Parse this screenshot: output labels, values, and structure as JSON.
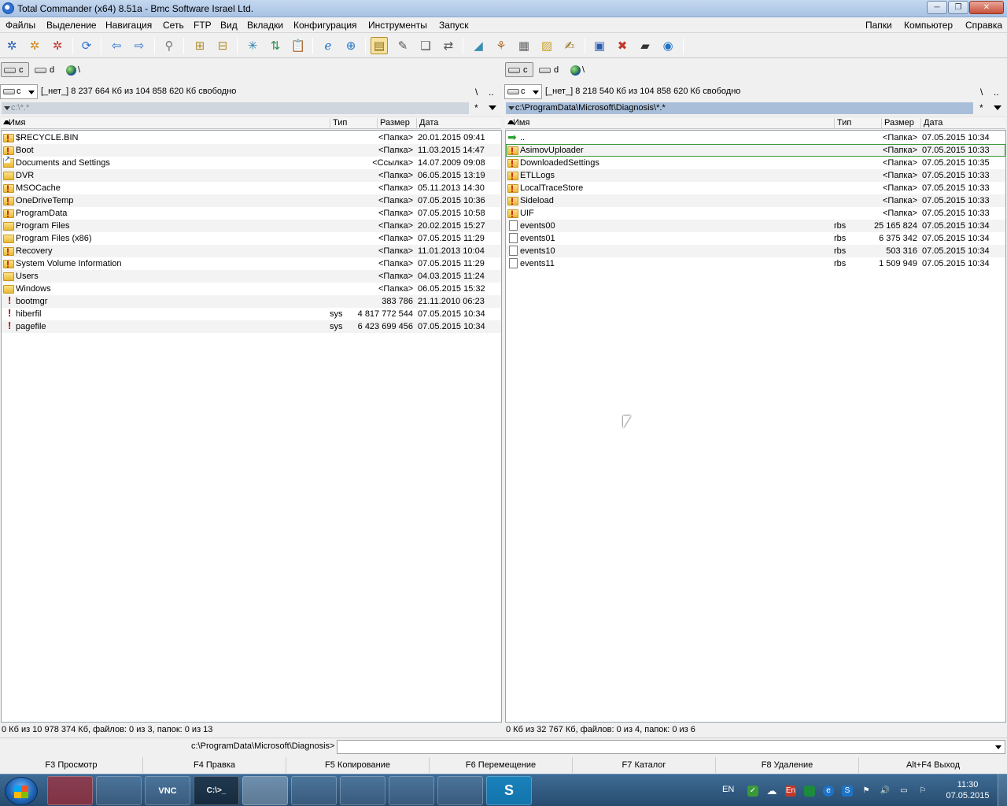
{
  "window": {
    "title": "Total Commander (x64) 8.51a - Bmc Software Israel Ltd."
  },
  "menu": {
    "left": [
      "Файлы",
      "Выделение",
      "Навигация",
      "Сеть",
      "FTP",
      "Вид",
      "Вкладки",
      "Конфигурация",
      "Инструменты",
      "Запуск"
    ],
    "right": [
      "Папки",
      "Компьютер",
      "Справка"
    ]
  },
  "toolbar": {
    "icons": [
      "gear-icon",
      "gear-icon",
      "gear-icon",
      "refresh-icon",
      "back-arrow-icon",
      "forward-arrow-icon",
      "search-icon",
      "pack-icon",
      "unpack-icon",
      "tree-icon",
      "sort-icon",
      "clipboard-icon",
      "ie-icon",
      "network-icon",
      "view-icon",
      "edit-icon",
      "copy-icon",
      "sync-icon",
      "disk-icon",
      "broom-icon",
      "calculator-icon",
      "notepad-icon",
      "notes-icon",
      "window-icon",
      "delete-icon",
      "terminal-icon",
      "globe-icon"
    ]
  },
  "left": {
    "drives": [
      "c",
      "d"
    ],
    "root": "\\",
    "combo": "c",
    "free": "[_нет_]  8 237 664 Кб из 104 858 620 Кб свободно",
    "path": "c:\\*.*",
    "cols": {
      "name": "Имя",
      "ext": "Тип",
      "size": "Размер",
      "date": "Дата"
    },
    "files": [
      {
        "icon": "excl-folder",
        "name": "$RECYCLE.BIN",
        "ext": "",
        "size": "<Папка>",
        "date": "20.01.2015 09:41"
      },
      {
        "icon": "excl-folder",
        "name": "Boot",
        "ext": "",
        "size": "<Папка>",
        "date": "11.03.2015 14:47"
      },
      {
        "icon": "link",
        "name": "Documents and Settings",
        "ext": "",
        "size": "<Ссылка>",
        "date": "14.07.2009 09:08"
      },
      {
        "icon": "folder",
        "name": "DVR",
        "ext": "",
        "size": "<Папка>",
        "date": "06.05.2015 13:19"
      },
      {
        "icon": "excl-folder",
        "name": "MSOCache",
        "ext": "",
        "size": "<Папка>",
        "date": "05.11.2013 14:30"
      },
      {
        "icon": "excl-folder",
        "name": "OneDriveTemp",
        "ext": "",
        "size": "<Папка>",
        "date": "07.05.2015 10:36"
      },
      {
        "icon": "excl-folder",
        "name": "ProgramData",
        "ext": "",
        "size": "<Папка>",
        "date": "07.05.2015 10:58"
      },
      {
        "icon": "folder",
        "name": "Program Files",
        "ext": "",
        "size": "<Папка>",
        "date": "20.02.2015 15:27"
      },
      {
        "icon": "folder",
        "name": "Program Files (x86)",
        "ext": "",
        "size": "<Папка>",
        "date": "07.05.2015 11:29"
      },
      {
        "icon": "excl-folder",
        "name": "Recovery",
        "ext": "",
        "size": "<Папка>",
        "date": "11.01.2013 10:04"
      },
      {
        "icon": "excl-folder",
        "name": "System Volume Information",
        "ext": "",
        "size": "<Папка>",
        "date": "07.05.2015 11:29"
      },
      {
        "icon": "folder",
        "name": "Users",
        "ext": "",
        "size": "<Папка>",
        "date": "04.03.2015 11:24"
      },
      {
        "icon": "folder",
        "name": "Windows",
        "ext": "",
        "size": "<Папка>",
        "date": "06.05.2015 15:32"
      },
      {
        "icon": "excl-file",
        "name": "bootmgr",
        "ext": "",
        "size": "383 786",
        "date": "21.11.2010 06:23"
      },
      {
        "icon": "excl-file",
        "name": "hiberfil",
        "ext": "sys",
        "size": "4 817 772 544",
        "date": "07.05.2015 10:34"
      },
      {
        "icon": "excl-file",
        "name": "pagefile",
        "ext": "sys",
        "size": "6 423 699 456",
        "date": "07.05.2015 10:34"
      }
    ],
    "status": "0 Кб из 10 978 374 Кб, файлов: 0 из 3, папок: 0 из 13"
  },
  "right": {
    "drives": [
      "c",
      "d"
    ],
    "root": "\\",
    "combo": "c",
    "free": "[_нет_]  8 218 540 Кб из 104 858 620 Кб свободно",
    "path": "c:\\ProgramData\\Microsoft\\Diagnosis\\*.*",
    "cols": {
      "name": "Имя",
      "ext": "Тип",
      "size": "Размер",
      "date": "Дата"
    },
    "files": [
      {
        "icon": "up",
        "name": "..",
        "ext": "",
        "size": "<Папка>",
        "date": "07.05.2015 10:34"
      },
      {
        "icon": "excl-folder",
        "name": "AsimovUploader",
        "ext": "",
        "size": "<Папка>",
        "date": "07.05.2015 10:33",
        "cursor": true
      },
      {
        "icon": "excl-folder",
        "name": "DownloadedSettings",
        "ext": "",
        "size": "<Папка>",
        "date": "07.05.2015 10:35"
      },
      {
        "icon": "excl-folder",
        "name": "ETLLogs",
        "ext": "",
        "size": "<Папка>",
        "date": "07.05.2015 10:33"
      },
      {
        "icon": "excl-folder",
        "name": "LocalTraceStore",
        "ext": "",
        "size": "<Папка>",
        "date": "07.05.2015 10:33"
      },
      {
        "icon": "excl-folder",
        "name": "Sideload",
        "ext": "",
        "size": "<Папка>",
        "date": "07.05.2015 10:33"
      },
      {
        "icon": "excl-folder",
        "name": "UIF",
        "ext": "",
        "size": "<Папка>",
        "date": "07.05.2015 10:33"
      },
      {
        "icon": "file",
        "name": "events00",
        "ext": "rbs",
        "size": "25 165 824",
        "date": "07.05.2015 10:34"
      },
      {
        "icon": "file",
        "name": "events01",
        "ext": "rbs",
        "size": "6 375 342",
        "date": "07.05.2015 10:34"
      },
      {
        "icon": "file",
        "name": "events10",
        "ext": "rbs",
        "size": "503 316",
        "date": "07.05.2015 10:34"
      },
      {
        "icon": "file",
        "name": "events11",
        "ext": "rbs",
        "size": "1 509 949",
        "date": "07.05.2015 10:34"
      }
    ],
    "status": "0 Кб из 32 767 Кб, файлов: 0 из 4, папок: 0 из 6"
  },
  "cmdline": {
    "path": "c:\\ProgramData\\Microsoft\\Diagnosis>",
    "value": ""
  },
  "fkeys": [
    "F3 Просмотр",
    "F4 Правка",
    "F5 Копирование",
    "F6 Перемещение",
    "F7 Каталог",
    "F8 Удаление",
    "Alt+F4 Выход"
  ],
  "taskbar": {
    "apps": [
      "acrobat-icon",
      "camera-icon",
      "vnc-icon",
      "cmd-icon",
      "app-icon",
      "monitor-icon",
      "floppy-icon",
      "notepad-icon",
      "folder-icon",
      "skype-icon"
    ],
    "app_labels": [
      "",
      "",
      "VNC",
      "C:\\>_",
      "",
      "",
      "",
      "",
      "",
      "S"
    ],
    "lang": "EN",
    "time": "11:30",
    "date": "07.05.2015"
  }
}
